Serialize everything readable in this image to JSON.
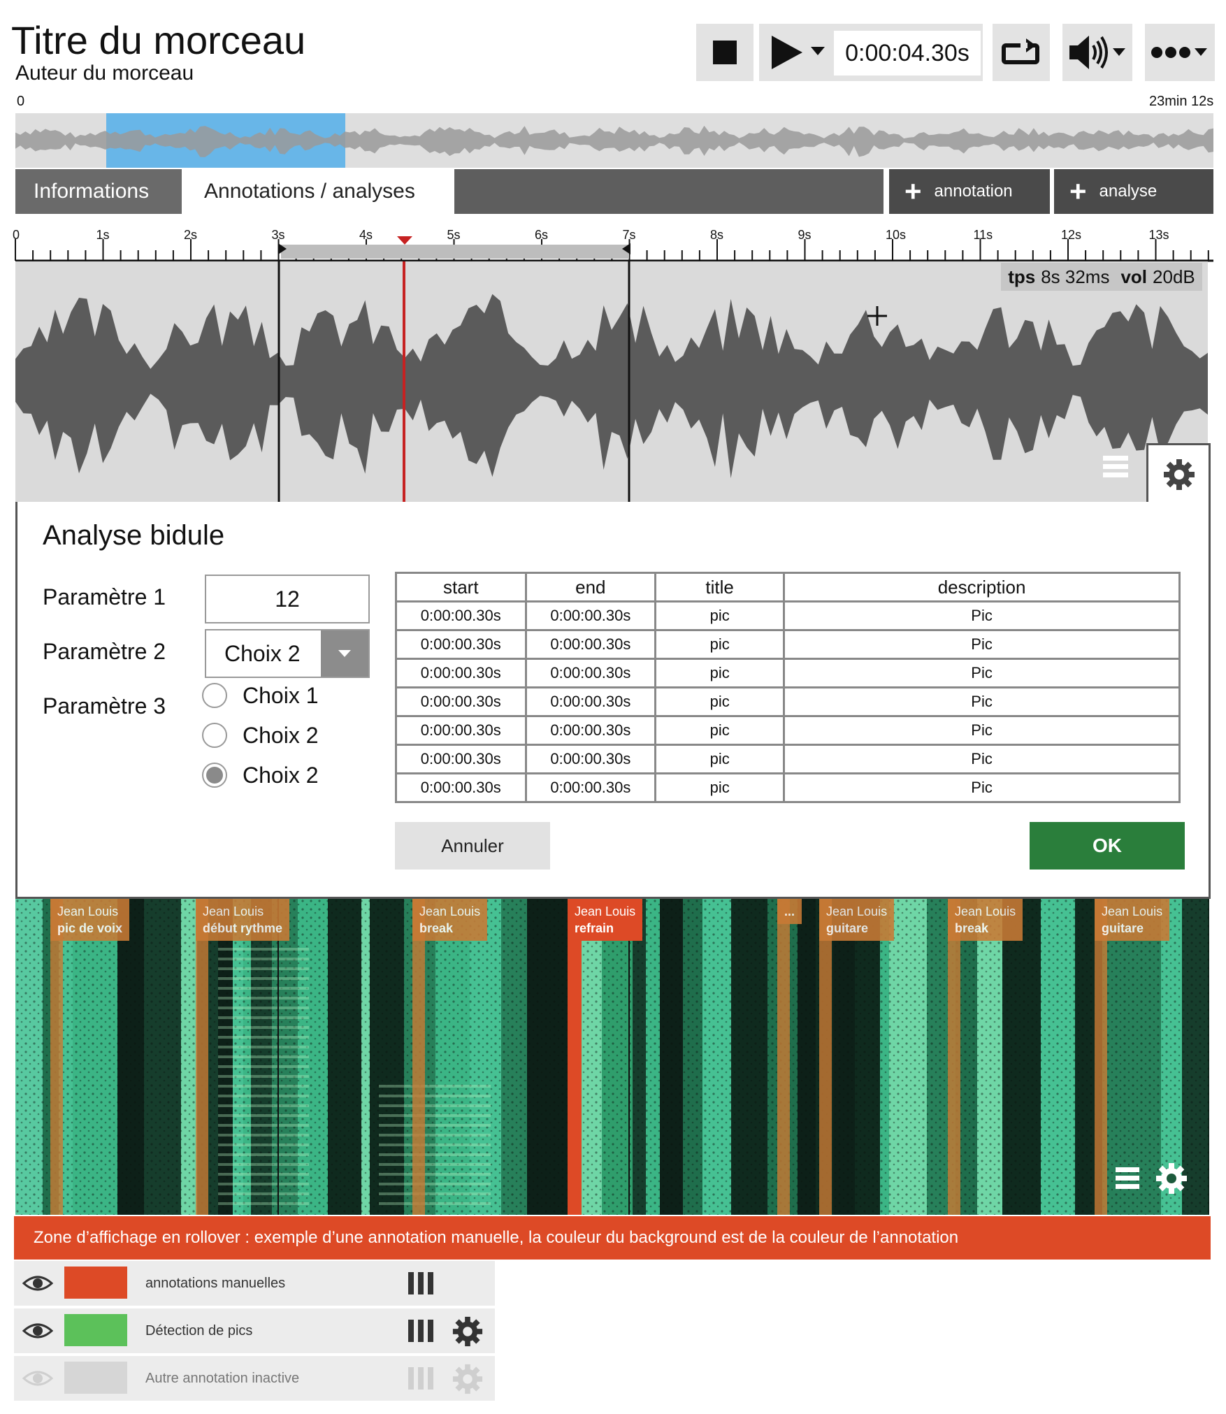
{
  "track": {
    "title": "Titre du morceau",
    "author": "Auteur du morceau"
  },
  "player": {
    "time": "0:00:04.30s"
  },
  "overview": {
    "start_label": "0",
    "end_label": "23min 12s"
  },
  "tabs": {
    "informations": "Informations",
    "annotations": "Annotations / analyses",
    "add_annotation": "annotation",
    "add_analyse": "analyse"
  },
  "ruler": {
    "labels": [
      "0",
      "1s",
      "2s",
      "3s",
      "4s",
      "5s",
      "6s",
      "7s",
      "8s",
      "9s",
      "10s",
      "11s",
      "12s",
      "13s"
    ]
  },
  "wave_info": {
    "tps_label": "tps",
    "tps_value": "8s 32ms",
    "vol_label": "vol",
    "vol_value": "20dB"
  },
  "dialog": {
    "title": "Analyse bidule",
    "param1_label": "Paramètre 1",
    "param1_value": "12",
    "param2_label": "Paramètre 2",
    "param2_value": "Choix 2",
    "param3_label": "Paramètre 3",
    "radio_options": [
      "Choix 1",
      "Choix 2",
      "Choix 2"
    ],
    "radio_selected": 2,
    "table_headers": [
      "start",
      "end",
      "title",
      "description"
    ],
    "table_rows": [
      [
        "0:00:00.30s",
        "0:00:00.30s",
        "pic",
        "Pic"
      ],
      [
        "0:00:00.30s",
        "0:00:00.30s",
        "pic",
        "Pic"
      ],
      [
        "0:00:00.30s",
        "0:00:00.30s",
        "pic",
        "Pic"
      ],
      [
        "0:00:00.30s",
        "0:00:00.30s",
        "pic",
        "Pic"
      ],
      [
        "0:00:00.30s",
        "0:00:00.30s",
        "pic",
        "Pic"
      ],
      [
        "0:00:00.30s",
        "0:00:00.30s",
        "pic",
        "Pic"
      ],
      [
        "0:00:00.30s",
        "0:00:00.30s",
        "pic",
        "Pic"
      ]
    ],
    "cancel_label": "Annuler",
    "ok_label": "OK"
  },
  "annotations": [
    {
      "author": "Jean Louis",
      "label": "pic de voix"
    },
    {
      "author": "Jean Louis",
      "label": "début rythme"
    },
    {
      "author": "Jean Louis",
      "label": "break"
    },
    {
      "author": "Jean Louis",
      "label": "refrain"
    },
    {
      "author": "",
      "label": "..."
    },
    {
      "author": "Jean Louis",
      "label": "guitare"
    },
    {
      "author": "Jean Louis",
      "label": "break"
    },
    {
      "author": "Jean Louis",
      "label": "guitare"
    }
  ],
  "banner": "Zone d’affichage en rollover : exemple d’une annotation manuelle, la couleur du background est de la couleur de l’annotation",
  "layers": [
    {
      "label": "annotations manuelles",
      "color": "#dd4a26"
    },
    {
      "label": "Détection de pics",
      "color": "#5cc15a"
    },
    {
      "label": "Autre annotation inactive",
      "color": "#d6d6d6"
    }
  ],
  "colors": {
    "selection": "#68b6e8",
    "playhead": "#c62222",
    "ok": "#2a7e3b",
    "annotation_active": "#dd4a26",
    "annotation_other": "#c97a35"
  }
}
